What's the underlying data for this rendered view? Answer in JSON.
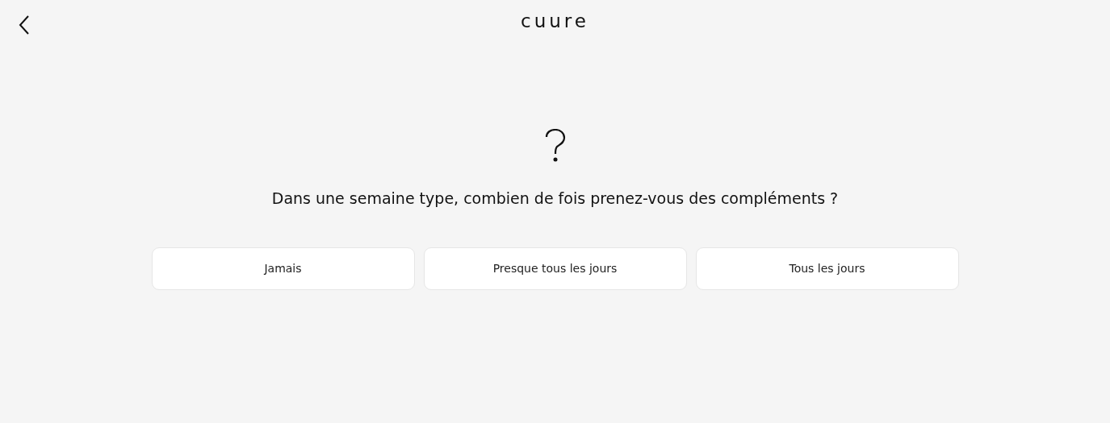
{
  "header": {
    "logo": "cuure"
  },
  "question": {
    "text": "Dans une semaine type, combien de fois prenez-vous des compléments ?"
  },
  "options": [
    {
      "label": "Jamais"
    },
    {
      "label": "Presque tous les jours"
    },
    {
      "label": "Tous les jours"
    }
  ]
}
